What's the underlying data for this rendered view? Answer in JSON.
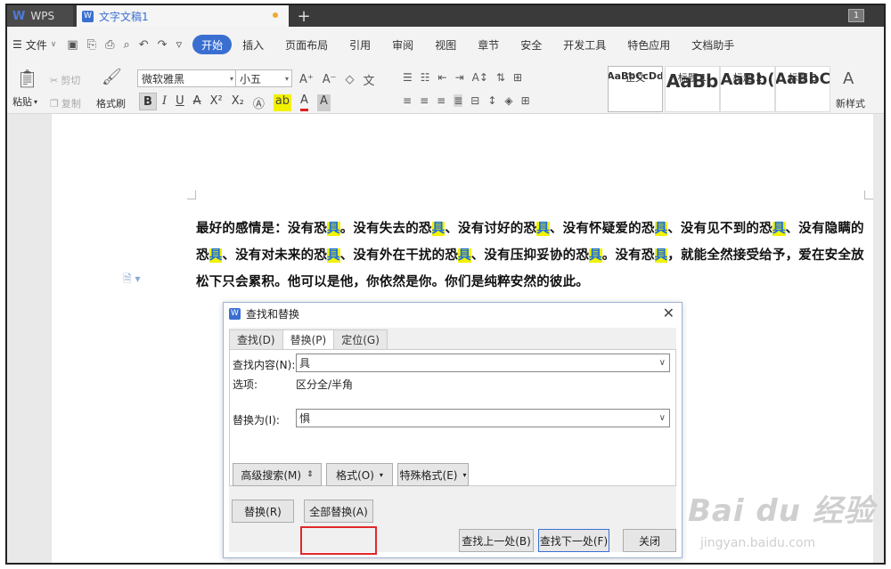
{
  "tabbar": {
    "app_label": "WPS",
    "doc_tab": "文字文稿1",
    "window_count": "1"
  },
  "menubar": {
    "file_label": "文件",
    "items": [
      "开始",
      "插入",
      "页面布局",
      "引用",
      "审阅",
      "视图",
      "章节",
      "安全",
      "开发工具",
      "特色应用",
      "文档助手"
    ],
    "active_index": 0
  },
  "ribbon": {
    "paste": "粘贴",
    "cut": "剪切",
    "copy": "复制",
    "format_painter": "格式刷",
    "font_name": "微软雅黑",
    "font_size": "小五",
    "bold": "B",
    "styles": [
      {
        "preview": "AaBbCcDd",
        "label": "正文"
      },
      {
        "preview": "AaBb",
        "label": "标题 1"
      },
      {
        "preview": "AaBb(",
        "label": "标题 2"
      },
      {
        "preview": "AaBbC",
        "label": "标题 3"
      }
    ],
    "new_style": "新样式"
  },
  "document": {
    "segments": [
      {
        "t": " 最好的感情是：没有恐",
        "h": false
      },
      {
        "t": "具",
        "h": true
      },
      {
        "t": "。没有失去的恐",
        "h": false
      },
      {
        "t": "具",
        "h": true
      },
      {
        "t": "、没有讨好的恐",
        "h": false
      },
      {
        "t": "具",
        "h": true
      },
      {
        "t": "、没有怀疑爱的恐",
        "h": false
      },
      {
        "t": "具",
        "h": true
      },
      {
        "t": "、没有见不到的恐",
        "h": false
      },
      {
        "t": "具",
        "h": true
      },
      {
        "t": "、没有隐瞒的恐",
        "h": false
      },
      {
        "t": "具",
        "h": true
      },
      {
        "t": "、没有对未来的恐",
        "h": false
      },
      {
        "t": "具",
        "h": true
      },
      {
        "t": "、没有外在干扰的恐",
        "h": false
      },
      {
        "t": "具",
        "h": true
      },
      {
        "t": "、没有压抑妥协的恐",
        "h": false
      },
      {
        "t": "具",
        "h": true
      },
      {
        "t": "。没有恐",
        "h": false
      },
      {
        "t": "具",
        "h": true
      },
      {
        "t": "，就能全然接受给予，爱在安全放松下只会累积。他可以是他，你依然是你。你们是纯粹安然的彼此。",
        "h": false
      }
    ]
  },
  "dialog": {
    "title": "查找和替换",
    "tabs": [
      "查找(D)",
      "替换(P)",
      "定位(G)"
    ],
    "selected_tab": 1,
    "find_label": "查找内容(N):",
    "find_value": "具",
    "options_label": "选项:",
    "options_value": "区分全/半角",
    "replace_label": "替换为(I):",
    "replace_value": "惧",
    "btn_advanced": "高级搜索(M)",
    "btn_format": "格式(O)",
    "btn_special": "特殊格式(E)",
    "btn_replace": "替换(R)",
    "btn_replace_all": "全部替换(A)",
    "btn_find_prev": "查找上一处(B)",
    "btn_find_next": "查找下一处(F)",
    "btn_close": "关闭"
  },
  "watermark": {
    "brand": "Bai du 经验",
    "url": "jingyan.baidu.com"
  }
}
